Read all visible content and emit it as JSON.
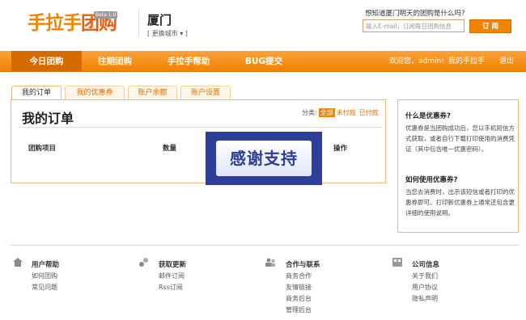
{
  "header": {
    "logo": {
      "name": "手拉手",
      "name_accent": "团购",
      "beta": "Beta 1.0"
    },
    "city": "厦门",
    "change_city": "[ 更换城市 ▾ ]",
    "subscribe_question": "想知道厦门明天的团购是什么吗?",
    "subscribe_placeholder": "输入E-mail，订阅每日团购信息",
    "subscribe_button": "订 阅"
  },
  "nav": {
    "items": [
      {
        "label": "今日团购",
        "active": true
      },
      {
        "label": "往期团购",
        "active": false
      },
      {
        "label": "手拉手帮助",
        "active": false
      },
      {
        "label": "BUG提交",
        "active": false
      }
    ],
    "welcome": "欢迎您，admin!",
    "my_account": "我的手拉手",
    "logout": "退出"
  },
  "tabs": [
    {
      "label": "我的订单",
      "active": true
    },
    {
      "label": "我的优惠券",
      "active": false
    },
    {
      "label": "账户余额",
      "active": false
    },
    {
      "label": "账户设置",
      "active": false
    }
  ],
  "main": {
    "title": "我的订单",
    "filter": {
      "label": "分类:",
      "options": [
        "全部",
        "未付款",
        "已付款"
      ],
      "active": "全部"
    },
    "columns": [
      "团购项目",
      "数量",
      "操作"
    ]
  },
  "overlay": {
    "text": "感谢支持"
  },
  "sidebar": {
    "sections": [
      {
        "heading": "什么是优惠券?",
        "body": "优惠券是当团购成功后，您以手机短信方式获取，或者自行下载打印使用的消费凭证（其中包含唯一优惠密码）。"
      },
      {
        "heading": "如何使用优惠券?",
        "body": "当您去消费时，出示该短信或者打印的优惠券即可。打印新优惠券上通常还包含更详细的使用说明。"
      }
    ]
  },
  "footer": {
    "columns": [
      {
        "icon": "house-icon",
        "title": "用户帮助",
        "links": [
          "如何团购",
          "常见问题"
        ]
      },
      {
        "icon": "gears-icon",
        "title": "获取更新",
        "links": [
          "邮件订阅",
          "Rss订阅"
        ]
      },
      {
        "icon": "people-icon",
        "title": "合作与联系",
        "links": [
          "商务合作",
          "友情链接",
          "商务后台",
          "管理后台"
        ]
      },
      {
        "icon": "building-icon",
        "title": "公司信息",
        "links": [
          "关于我们",
          "用户协议",
          "隐私声明"
        ]
      }
    ]
  },
  "colors": {
    "brand_orange": "#f08300",
    "border_orange": "#f3b873",
    "overlay_blue": "#2d3f96"
  }
}
